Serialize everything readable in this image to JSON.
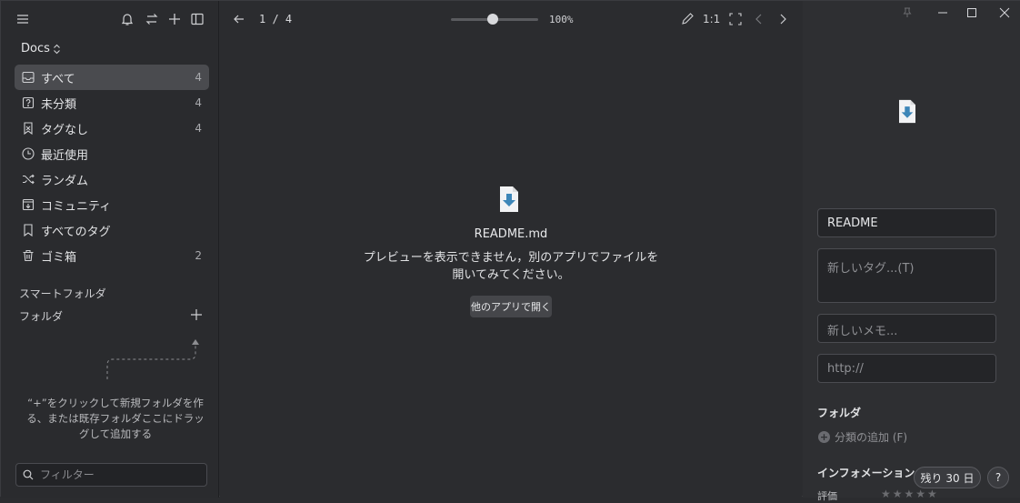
{
  "sidebar": {
    "library_name": "Docs",
    "nav_items": [
      {
        "label": "すべて",
        "count": "4",
        "icon": "inbox-icon"
      },
      {
        "label": "未分類",
        "count": "4",
        "icon": "question-box-icon"
      },
      {
        "label": "タグなし",
        "count": "4",
        "icon": "untagged-icon"
      },
      {
        "label": "最近使用",
        "count": "",
        "icon": "clock-icon"
      },
      {
        "label": "ランダム",
        "count": "",
        "icon": "shuffle-icon"
      },
      {
        "label": "コミュニティ",
        "count": "",
        "icon": "community-icon"
      },
      {
        "label": "すべてのタグ",
        "count": "",
        "icon": "bookmark-icon"
      },
      {
        "label": "ゴミ箱",
        "count": "2",
        "icon": "trash-icon"
      }
    ],
    "smart_folder_label": "スマートフォルダ",
    "folder_label": "フォルダ",
    "folder_hint": "“+”をクリックして新規フォルダを作る、または既存フォルダここにドラッグして追加する",
    "filter_placeholder": "フィルター"
  },
  "viewer": {
    "pager": "1 / 4",
    "zoom": "100%",
    "zoom_fraction": 0.48,
    "ratio_label": "1:1",
    "file_name": "README.md",
    "message": "プレビューを表示できません，別のアプリでファイルを開いてみてください。",
    "open_button": "他のアプリで開く"
  },
  "inspector": {
    "name_value": "README",
    "tags_placeholder": "新しいタグ...(T)",
    "note_placeholder": "新しいメモ...",
    "url_placeholder": "http://",
    "folder_heading": "フォルダ",
    "add_classification": "分類の追加 (F)",
    "info_heading": "インフォメーション",
    "trial_badge": "残り 30 日",
    "help_label": "?",
    "rating_label": "評価"
  }
}
